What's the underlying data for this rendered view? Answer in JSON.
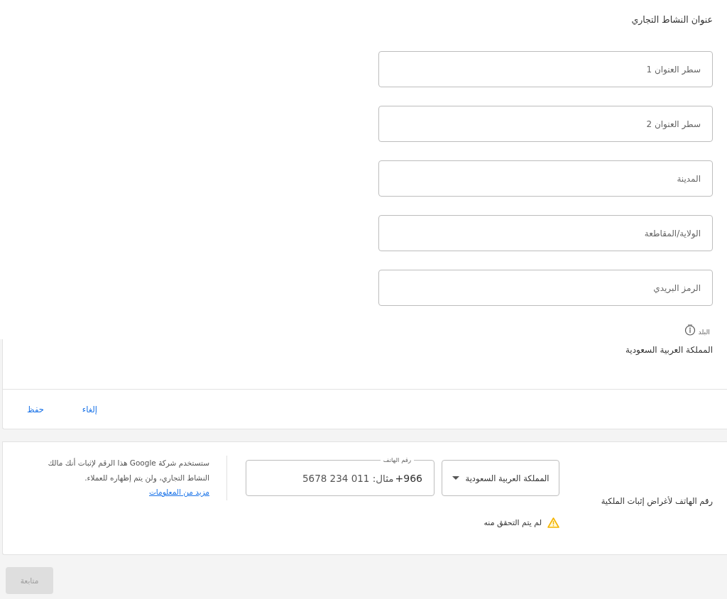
{
  "address": {
    "title": "عنوان النشاط التجاري",
    "fields": [
      {
        "placeholder": "سطر العنوان 1"
      },
      {
        "placeholder": "سطر العنوان 2"
      },
      {
        "placeholder": "المدينة"
      },
      {
        "placeholder": "الولاية/المقاطعة"
      },
      {
        "placeholder": "الرمز البريدي"
      }
    ],
    "country": {
      "label": "البلد",
      "value": "المملكة العربية السعودية"
    }
  },
  "actions": [
    {
      "label": "إلغاء"
    },
    {
      "label": "حفظ"
    }
  ],
  "phone_verification": {
    "label": "رقم الهاتف لأغراض إثبات الملكية",
    "country_select": {
      "value": "المملكة العربية السعودية"
    },
    "phone_field": {
      "label": "رقم الهاتف",
      "prefix": "+966",
      "placeholder": "مثال: 011 234 5678"
    },
    "status": {
      "verified": false,
      "text": "لم يتم التحقق منه"
    },
    "info": {
      "text": "ستستخدم شركة Google هذا الرقم لإثبات أنك مالك النشاط التجاري، ولن يتم إظهاره للعملاء.",
      "link": "مزيد من المعلومات"
    }
  },
  "continue_button": {
    "label": "متابعة",
    "disabled": true
  }
}
